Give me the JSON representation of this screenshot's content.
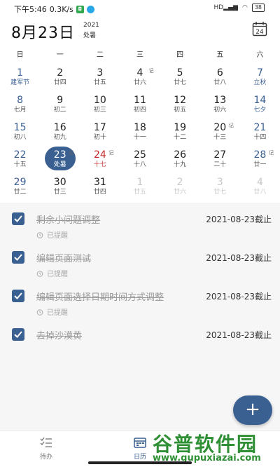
{
  "status_bar": {
    "time": "下午5:46",
    "speed": "0.3K/s",
    "battery": "38"
  },
  "header": {
    "date": "8月23日",
    "year": "2021",
    "solar_term": "处暑",
    "calendar_button_day": "24"
  },
  "weekdays": [
    "日",
    "一",
    "二",
    "三",
    "四",
    "五",
    "六"
  ],
  "calendar": [
    {
      "num": "1",
      "sub": "建军节",
      "cls": "sun festival"
    },
    {
      "num": "2",
      "sub": "廿四",
      "cls": ""
    },
    {
      "num": "3",
      "sub": "廿五",
      "cls": ""
    },
    {
      "num": "4",
      "sub": "廿六",
      "cls": "",
      "mark": "记"
    },
    {
      "num": "5",
      "sub": "廿七",
      "cls": ""
    },
    {
      "num": "6",
      "sub": "廿八",
      "cls": ""
    },
    {
      "num": "7",
      "sub": "立秋",
      "cls": "sat festival"
    },
    {
      "num": "8",
      "sub": "七月",
      "cls": "sun"
    },
    {
      "num": "9",
      "sub": "初二",
      "cls": ""
    },
    {
      "num": "10",
      "sub": "初三",
      "cls": ""
    },
    {
      "num": "11",
      "sub": "初四",
      "cls": ""
    },
    {
      "num": "12",
      "sub": "初五",
      "cls": ""
    },
    {
      "num": "13",
      "sub": "初六",
      "cls": ""
    },
    {
      "num": "14",
      "sub": "七夕",
      "cls": "sat festival"
    },
    {
      "num": "15",
      "sub": "初八",
      "cls": "sun"
    },
    {
      "num": "16",
      "sub": "初九",
      "cls": ""
    },
    {
      "num": "17",
      "sub": "初十",
      "cls": ""
    },
    {
      "num": "18",
      "sub": "十一",
      "cls": ""
    },
    {
      "num": "19",
      "sub": "十二",
      "cls": ""
    },
    {
      "num": "20",
      "sub": "十三",
      "cls": "",
      "mark": "记"
    },
    {
      "num": "21",
      "sub": "十四",
      "cls": "sat"
    },
    {
      "num": "22",
      "sub": "十五",
      "cls": "sun"
    },
    {
      "num": "23",
      "sub": "处暑",
      "cls": "selected",
      "mark": "记"
    },
    {
      "num": "24",
      "sub": "十七",
      "cls": "today",
      "mark": "记"
    },
    {
      "num": "25",
      "sub": "十八",
      "cls": ""
    },
    {
      "num": "26",
      "sub": "十九",
      "cls": ""
    },
    {
      "num": "27",
      "sub": "二十",
      "cls": ""
    },
    {
      "num": "28",
      "sub": "廿一",
      "cls": "sat",
      "mark": "记"
    },
    {
      "num": "29",
      "sub": "廿二",
      "cls": "sun"
    },
    {
      "num": "30",
      "sub": "廿三",
      "cls": ""
    },
    {
      "num": "31",
      "sub": "廿四",
      "cls": ""
    },
    {
      "num": "1",
      "sub": "廿五",
      "cls": "other"
    },
    {
      "num": "2",
      "sub": "廿六",
      "cls": "other"
    },
    {
      "num": "3",
      "sub": "廿七",
      "cls": "other"
    },
    {
      "num": "4",
      "sub": "廿八",
      "cls": "other"
    }
  ],
  "tasks": [
    {
      "title": "剩余小问题调整",
      "due": "2021-08-23截止",
      "remind": "已提醒"
    },
    {
      "title": "编辑页面测试",
      "due": "2021-08-23截止",
      "remind": "已提醒"
    },
    {
      "title": "编辑页面选择日期时间方式调整",
      "due": "2021-08-23截止",
      "remind": "已提醒"
    },
    {
      "title": "去掉沙漠黄",
      "due": "2021-08-23截止"
    }
  ],
  "fab_label": "+",
  "bottom_nav": {
    "todo": "待办",
    "calendar": "日历"
  },
  "watermark": {
    "main": "谷普软件园",
    "url": "www.gupuxiazai.com"
  },
  "colors": {
    "accent": "#3a5f91",
    "today": "#c62828",
    "watermark": "#2f8f34"
  }
}
